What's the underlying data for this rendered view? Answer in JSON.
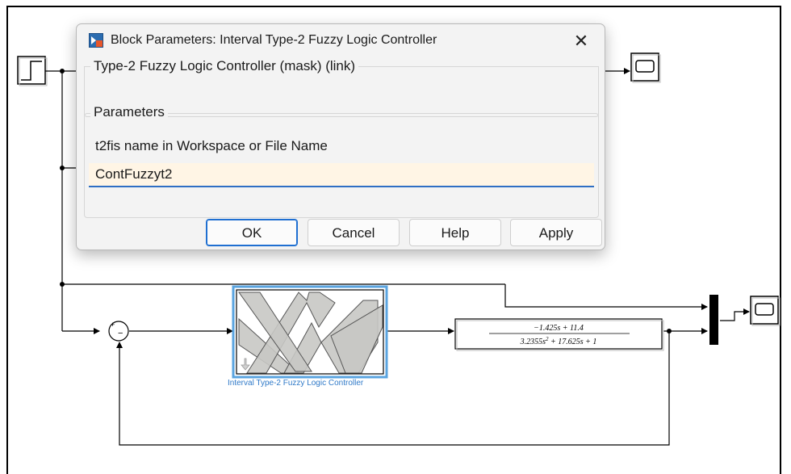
{
  "dialog": {
    "title": "Block Parameters: Interval Type-2 Fuzzy Logic Controller",
    "close_glyph": "✕",
    "mask_title": "Type-2 Fuzzy Logic Controller (mask) (link)",
    "params_title": "Parameters",
    "fis_label": "t2fis name in Workspace or File Name",
    "fis_value": "ContFuzzyt2",
    "buttons": {
      "ok": "OK",
      "cancel": "Cancel",
      "help": "Help",
      "apply": "Apply"
    },
    "icons": {
      "app": "simulink-block-icon",
      "close": "close-icon"
    }
  },
  "model": {
    "flc_block_label": "Interval Type-2 Fuzzy Logic Controller",
    "sum_signs": {
      "plus": "+",
      "minus": "−"
    },
    "transfer_function": {
      "numerator": "−1.425s + 11.4",
      "denominator_a": "3.2355s",
      "denominator_exp": "2",
      "denominator_b": " + 17.625s + 1"
    },
    "colors": {
      "selection": "#2e79c8",
      "link": "#2e79c8"
    }
  }
}
